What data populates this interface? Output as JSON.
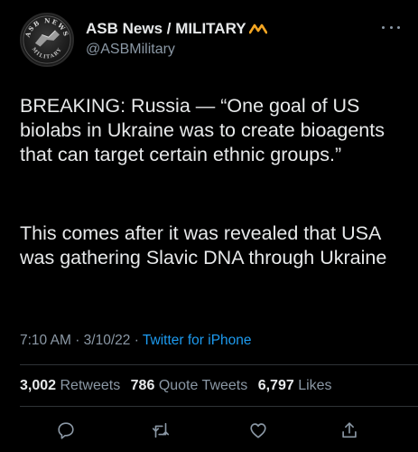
{
  "author": {
    "name": "ASB News / MILITARY",
    "handle": "@ASBMilitary",
    "avatar_text_top": "ASB NEWS",
    "avatar_text_bottom": "MILITARY",
    "verified_mark_color": "#f5a623"
  },
  "tweet": {
    "paragraphs": [
      "BREAKING: Russia — “One goal of US biolabs in Ukraine was to create bioagents that can target certain ethnic groups.”",
      "This comes after it was revealed that USA was gathering Slavic DNA through Ukraine"
    ],
    "time": "7:10 AM",
    "date": "3/10/22",
    "separator": "·",
    "source": "Twitter for iPhone"
  },
  "stats": {
    "retweets_count": "3,002",
    "retweets_label": "Retweets",
    "quotes_count": "786",
    "quotes_label": "Quote Tweets",
    "likes_count": "6,797",
    "likes_label": "Likes"
  },
  "actions": [
    "reply-icon",
    "retweet-icon",
    "like-icon",
    "share-icon"
  ],
  "colors": {
    "background": "#000000",
    "text": "#e7e9ea",
    "muted": "#8b98a5",
    "link": "#1d9bf0"
  }
}
